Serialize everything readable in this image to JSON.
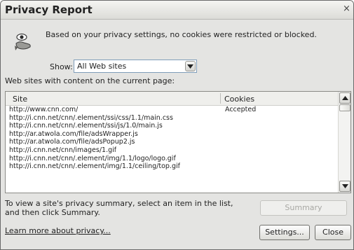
{
  "window": {
    "title": "Privacy Report",
    "close_glyph": "×"
  },
  "summary_message": "Based on your privacy settings, no cookies were restricted or blocked.",
  "filter": {
    "label": "Show:",
    "selected": "All Web sites",
    "arrow_glyph": "▾"
  },
  "sites_caption": "Web sites with content on the current page:",
  "table": {
    "columns": [
      "Site",
      "Cookies"
    ],
    "rows": [
      {
        "site": "http://www.cnn.com/",
        "cookies": "Accepted"
      },
      {
        "site": "http://i.cnn.net/cnn/.element/ssi/css/1.1/main.css",
        "cookies": ""
      },
      {
        "site": "http://i.cnn.net/cnn/.element/ssi/js/1.0/main.js",
        "cookies": ""
      },
      {
        "site": "http://ar.atwola.com/file/adsWrapper.js",
        "cookies": ""
      },
      {
        "site": "http://ar.atwola.com/file/adsPopup2.js",
        "cookies": ""
      },
      {
        "site": "http://i.cnn.net/cnn/images/1.gif",
        "cookies": ""
      },
      {
        "site": "http://i.cnn.net/cnn/.element/img/1.1/logo/logo.gif",
        "cookies": ""
      },
      {
        "site": "http://i.cnn.net/cnn/.element/img/1.1/ceiling/top.gif",
        "cookies": ""
      }
    ]
  },
  "hint": "To view a site's privacy summary, select an item in the list, and then click Summary.",
  "buttons": {
    "summary": "Summary",
    "settings": "Settings...",
    "close": "Close"
  },
  "learn_more": "Learn more about privacy...",
  "colors": {
    "dialog_bg": "#e4e4e2",
    "list_bg": "#ffffff",
    "disabled_text": "#a8a8a4"
  },
  "icons": [
    "privacy-eye-icon",
    "dropdown-arrow-icon",
    "scroll-up-icon",
    "scroll-down-icon",
    "close-icon"
  ]
}
